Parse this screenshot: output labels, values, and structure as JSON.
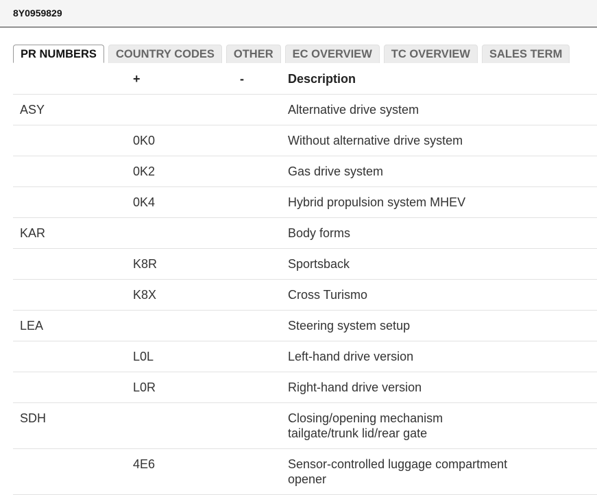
{
  "header": {
    "title": "8Y0959829"
  },
  "tabs": [
    {
      "label": "PR NUMBERS",
      "active": true
    },
    {
      "label": "COUNTRY CODES",
      "active": false
    },
    {
      "label": "OTHER",
      "active": false
    },
    {
      "label": "EC OVERVIEW",
      "active": false
    },
    {
      "label": "TC OVERVIEW",
      "active": false
    },
    {
      "label": "SALES TERM",
      "active": false
    }
  ],
  "table": {
    "columns": {
      "group": "",
      "plus": "+",
      "minus": "-",
      "description": "Description"
    },
    "rows": [
      {
        "group": "ASY",
        "plus": "",
        "minus": "",
        "description": "Alternative drive system"
      },
      {
        "group": "",
        "plus": "0K0",
        "minus": "",
        "description": "Without alternative drive system"
      },
      {
        "group": "",
        "plus": "0K2",
        "minus": "",
        "description": "Gas drive system"
      },
      {
        "group": "",
        "plus": "0K4",
        "minus": "",
        "description": "Hybrid propulsion system MHEV"
      },
      {
        "group": "KAR",
        "plus": "",
        "minus": "",
        "description": "Body forms"
      },
      {
        "group": "",
        "plus": "K8R",
        "minus": "",
        "description": "Sportsback"
      },
      {
        "group": "",
        "plus": "K8X",
        "minus": "",
        "description": "Cross Turismo"
      },
      {
        "group": "LEA",
        "plus": "",
        "minus": "",
        "description": "Steering system setup"
      },
      {
        "group": "",
        "plus": "L0L",
        "minus": "",
        "description": "Left-hand drive version"
      },
      {
        "group": "",
        "plus": "L0R",
        "minus": "",
        "description": "Right-hand drive version"
      },
      {
        "group": "SDH",
        "plus": "",
        "minus": "",
        "description": "Closing/opening mechanism tailgate/trunk lid/rear gate"
      },
      {
        "group": "",
        "plus": "4E6",
        "minus": "",
        "description": "Sensor-controlled luggage compartment opener"
      }
    ]
  }
}
